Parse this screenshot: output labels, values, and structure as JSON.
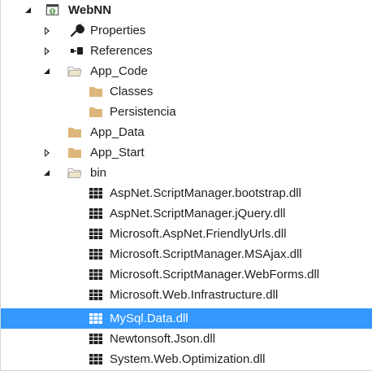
{
  "tree": {
    "project": {
      "label": "WebNN",
      "icon": "web-project-icon"
    },
    "properties": {
      "label": "Properties",
      "icon": "wrench-icon"
    },
    "references": {
      "label": "References",
      "icon": "references-icon"
    },
    "app_code": {
      "label": "App_Code",
      "icon": "folder-open-icon",
      "children": [
        {
          "label": "Classes",
          "icon": "folder-icon"
        },
        {
          "label": "Persistencia",
          "icon": "folder-icon"
        }
      ]
    },
    "app_data": {
      "label": "App_Data",
      "icon": "folder-icon"
    },
    "app_start": {
      "label": "App_Start",
      "icon": "folder-icon"
    },
    "bin": {
      "label": "bin",
      "icon": "folder-open-icon",
      "files": [
        {
          "label": "AspNet.ScriptManager.bootstrap.dll",
          "icon": "dll-icon"
        },
        {
          "label": "AspNet.ScriptManager.jQuery.dll",
          "icon": "dll-icon"
        },
        {
          "label": "Microsoft.AspNet.FriendlyUrls.dll",
          "icon": "dll-icon"
        },
        {
          "label": "Microsoft.ScriptManager.MSAjax.dll",
          "icon": "dll-icon"
        },
        {
          "label": "Microsoft.ScriptManager.WebForms.dll",
          "icon": "dll-icon"
        },
        {
          "label": "Microsoft.Web.Infrastructure.dll",
          "icon": "dll-icon"
        },
        {
          "label": "MySql.Data.dll",
          "icon": "dll-icon",
          "selected": true
        },
        {
          "label": "Newtonsoft.Json.dll",
          "icon": "dll-icon"
        },
        {
          "label": "System.Web.Optimization.dll",
          "icon": "dll-icon"
        }
      ]
    }
  },
  "colors": {
    "selection": "#3399ff",
    "folder": "#dcb67a",
    "text": "#1e1e1e"
  }
}
